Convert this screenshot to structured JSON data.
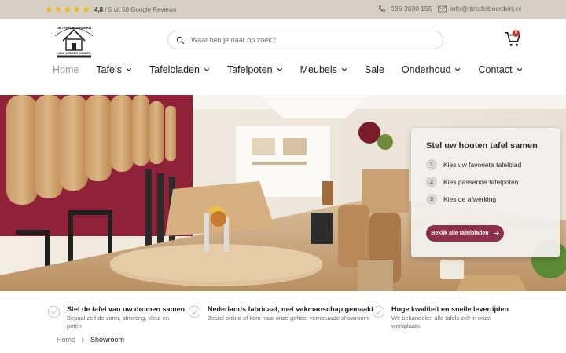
{
  "topbar": {
    "rating_value": "4,8",
    "rating_text": " / 5 uit 50 Google Reviews",
    "phone": "036-3030 155",
    "email": "info@detafelboerderij.nl"
  },
  "header": {
    "logo_text": "De Tafelboerderij",
    "logo_tagline": "KIES. CREEER. GENIET.",
    "search_placeholder": "Waar ben je naar op zoek?",
    "cart_count": "0"
  },
  "nav": {
    "items": [
      {
        "label": "Home"
      },
      {
        "label": "Tafels"
      },
      {
        "label": "Tafelbladen"
      },
      {
        "label": "Tafelpoten"
      },
      {
        "label": "Meubels"
      },
      {
        "label": "Sale"
      },
      {
        "label": "Onderhoud"
      },
      {
        "label": "Contact"
      }
    ]
  },
  "hero_panel": {
    "title": "Stel uw houten tafel samen",
    "steps": [
      {
        "num": "1",
        "label": "Kies uw favoriete tafelblad"
      },
      {
        "num": "2",
        "label": "Kies passende tafelpoten"
      },
      {
        "num": "3",
        "label": "Kies de afwerking"
      }
    ],
    "button_label": "Bekijk alle tafelbladen"
  },
  "usps": [
    {
      "title": "Stel de tafel van uw dromen samen",
      "desc": "Bepaal zelf de vorm, afmeting, kleur en potén"
    },
    {
      "title": "Nederlands fabricaat, met vakmanschap gemaakt",
      "desc": "Bestel online of kom naar onze geheel vernieuwde showroom"
    },
    {
      "title": "Hoge kwaliteit en snelle levertijden",
      "desc": "We behandelen alle tafels zelf in onze werkplaats"
    }
  ],
  "breadcrumb": {
    "home": "Home",
    "current": "Showroom"
  },
  "colors": {
    "topbar_bg": "#d6d0c4",
    "accent": "#8c2f4a",
    "star": "#f2b515"
  }
}
